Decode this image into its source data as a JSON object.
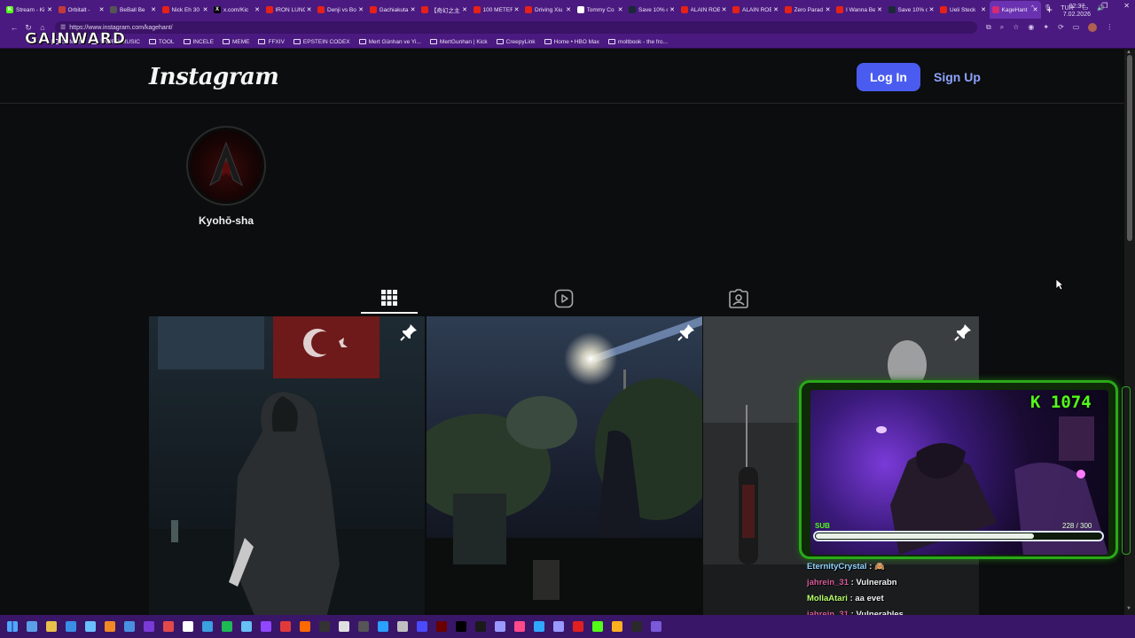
{
  "browser": {
    "tabs": [
      {
        "title": "Stream - Ki",
        "favicon_color": "#53fc18",
        "fav_letter": "K"
      },
      {
        "title": "Orbitalt -",
        "favicon_color": "#c23b3b",
        "fav_letter": ""
      },
      {
        "title": "BeBall Be",
        "favicon_color": "#555555",
        "fav_letter": ""
      },
      {
        "title": "Nick Eh 30",
        "favicon_color": "#e62117",
        "fav_letter": ""
      },
      {
        "title": "x.com/Kic",
        "favicon_color": "#000000",
        "fav_letter": "X"
      },
      {
        "title": "IRON LUNG",
        "favicon_color": "#e62117",
        "fav_letter": ""
      },
      {
        "title": "Denji vs Bo",
        "favicon_color": "#e62117",
        "fav_letter": ""
      },
      {
        "title": "Gachiakuta",
        "favicon_color": "#e62117",
        "fav_letter": ""
      },
      {
        "title": "【奇幻之主】",
        "favicon_color": "#e62117",
        "fav_letter": ""
      },
      {
        "title": "100 METER",
        "favicon_color": "#e62117",
        "fav_letter": ""
      },
      {
        "title": "Driving Xiu",
        "favicon_color": "#e62117",
        "fav_letter": ""
      },
      {
        "title": "Tommy Co",
        "favicon_color": "#ffffff",
        "fav_letter": "W"
      },
      {
        "title": "Save 10% o",
        "favicon_color": "#1b2838",
        "fav_letter": ""
      },
      {
        "title": "ALAIN ROB",
        "favicon_color": "#e62117",
        "fav_letter": ""
      },
      {
        "title": "ALAIN ROB",
        "favicon_color": "#e62117",
        "fav_letter": ""
      },
      {
        "title": "Zero Parad",
        "favicon_color": "#e62117",
        "fav_letter": ""
      },
      {
        "title": "I Wanna Be",
        "favicon_color": "#e62117",
        "fav_letter": ""
      },
      {
        "title": "Save 10% o",
        "favicon_color": "#1b2838",
        "fav_letter": ""
      },
      {
        "title": "Ueli Steck",
        "favicon_color": "#e62117",
        "fav_letter": ""
      },
      {
        "title": "KageHant",
        "favicon_color": "#d62976",
        "fav_letter": ""
      }
    ],
    "url": "https://www.instagram.com/kagehant/",
    "bookmarks": [
      "GAMES",
      "WEIRD MUSIC",
      "TOOL",
      "INCELE",
      "MEME",
      "FFXIV",
      "EPSTEIN CODEX",
      "Mert Günhan ve Yi...",
      "MertGunhan | Kick",
      "CreepyLink",
      "Home • HBO Max",
      "moltbook - the fro..."
    ],
    "overlay_brand": "GAINWARD"
  },
  "instagram": {
    "logo": "Instagram",
    "login_label": "Log In",
    "signup_label": "Sign Up",
    "username": "Kyohō-sha"
  },
  "stream_overlay": {
    "kick_count": "K 1074",
    "sub_label": "SUB",
    "sub_progress": "228  / 300",
    "sub_fraction": 0.76,
    "accent": "#53fc18",
    "chat": [
      {
        "user": "EternityCrystal",
        "color": "#8fd3ff",
        "message": "🙈"
      },
      {
        "user": "jahrein_31",
        "color": "#d85a9a",
        "message": "Vulnerabn"
      },
      {
        "user": "MollaAtari",
        "color": "#b7ff6b",
        "message": "aa evet"
      },
      {
        "user": "jahrein_31",
        "color": "#d85a9a",
        "message": "Vulnerables"
      }
    ]
  },
  "taskbar": {
    "lang": "TUR",
    "time": "02:37",
    "date": "7.02.2026"
  }
}
